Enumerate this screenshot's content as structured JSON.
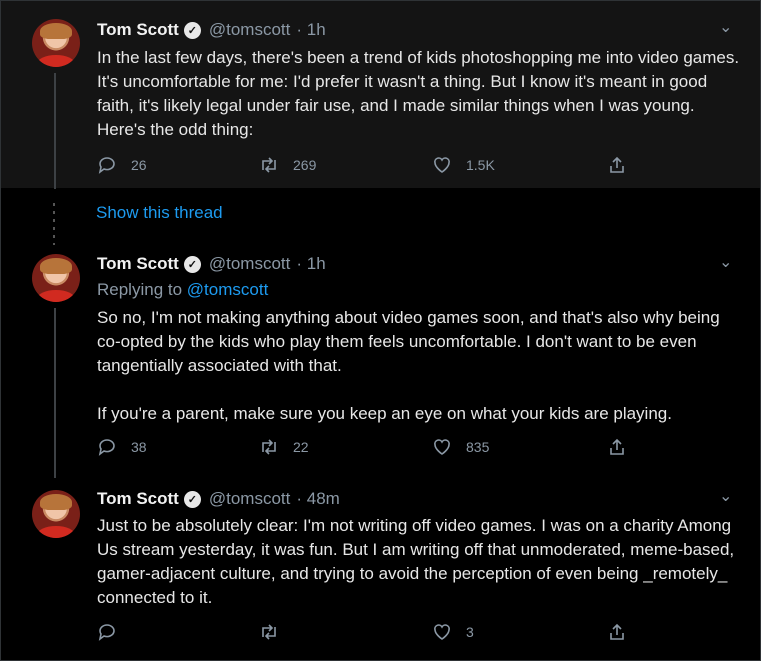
{
  "tweets": [
    {
      "name": "Tom Scott",
      "handle": "@tomscott",
      "time": "· 1h",
      "text": "In the last few days, there's been a trend of kids photoshopping me into video games. It's uncomfortable for me: I'd prefer it wasn't a thing. But I know it's meant in good faith, it's likely legal under fair use, and I made similar things when I was young. Here's the odd thing:",
      "replies": "26",
      "retweets": "269",
      "likes": "1.5K"
    },
    {
      "name": "Tom Scott",
      "handle": "@tomscott",
      "time": "· 1h",
      "replying_label": "Replying to",
      "replying_handle": "@tomscott",
      "text": "So no, I'm not making anything about video games soon, and that's also why being co-opted by the kids who play them feels uncomfortable. I don't want to be even tangentially associated with that.\n\nIf you're a parent, make sure you keep an eye on what your kids are playing.",
      "replies": "38",
      "retweets": "22",
      "likes": "835"
    },
    {
      "name": "Tom Scott",
      "handle": "@tomscott",
      "time": "· 48m",
      "text": "Just to be absolutely clear: I'm not writing off video games. I was on a charity Among Us stream yesterday, it was fun. But I am writing off that unmoderated, meme-based, gamer-adjacent culture, and trying to avoid the perception of even being _remotely_ connected to it.",
      "replies": "",
      "retweets": "",
      "likes": "3"
    }
  ],
  "show_thread": "Show this thread",
  "colors": {
    "background": "#000000",
    "highlight": "#141414",
    "link": "#1d9bf0",
    "muted": "#8b98a5"
  },
  "icons": [
    "reply-icon",
    "retweet-icon",
    "like-icon",
    "share-icon",
    "verified-icon",
    "caret-down-icon"
  ]
}
